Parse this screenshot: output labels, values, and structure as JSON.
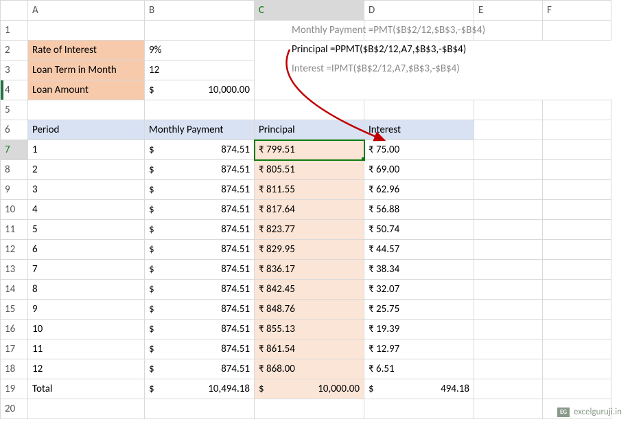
{
  "columns": [
    "A",
    "B",
    "C",
    "D",
    "E",
    "F"
  ],
  "labels": {
    "rate": "Rate of Interest",
    "term": "Loan Term in Month",
    "amount": "Loan Amount"
  },
  "values": {
    "rate": "9%",
    "term": "12",
    "amount_sym": "$",
    "amount_val": "10,000.00"
  },
  "headers": {
    "period": "Period",
    "monthly": "Monthly Payment",
    "principal": "Principal",
    "interest": "Interest"
  },
  "rows": [
    {
      "r": "7",
      "p": "1",
      "m": "874.51",
      "pr": "₹ 799.51",
      "it": "₹ 75.00"
    },
    {
      "r": "8",
      "p": "2",
      "m": "874.51",
      "pr": "₹ 805.51",
      "it": "₹ 69.00"
    },
    {
      "r": "9",
      "p": "3",
      "m": "874.51",
      "pr": "₹ 811.55",
      "it": "₹ 62.96"
    },
    {
      "r": "10",
      "p": "4",
      "m": "874.51",
      "pr": "₹ 817.64",
      "it": "₹ 56.88"
    },
    {
      "r": "11",
      "p": "5",
      "m": "874.51",
      "pr": "₹ 823.77",
      "it": "₹ 50.74"
    },
    {
      "r": "12",
      "p": "6",
      "m": "874.51",
      "pr": "₹ 829.95",
      "it": "₹ 44.57"
    },
    {
      "r": "13",
      "p": "7",
      "m": "874.51",
      "pr": "₹ 836.17",
      "it": "₹ 38.34"
    },
    {
      "r": "14",
      "p": "8",
      "m": "874.51",
      "pr": "₹ 842.45",
      "it": "₹ 32.07"
    },
    {
      "r": "15",
      "p": "9",
      "m": "874.51",
      "pr": "₹ 848.76",
      "it": "₹ 25.75"
    },
    {
      "r": "16",
      "p": "10",
      "m": "874.51",
      "pr": "₹ 855.13",
      "it": "₹ 19.39"
    },
    {
      "r": "17",
      "p": "11",
      "m": "874.51",
      "pr": "₹ 861.54",
      "it": "₹ 12.97"
    },
    {
      "r": "18",
      "p": "12",
      "m": "874.51",
      "pr": "₹ 868.00",
      "it": "₹ 6.51"
    }
  ],
  "total": {
    "r": "19",
    "label": "Total",
    "m_sym": "$",
    "m_val": "10,494.18",
    "pr_sym": "$",
    "pr_val": "10,000.00",
    "it_sym": "$",
    "it_val": "494.18"
  },
  "formulas": {
    "f1": "Monthly Payment =PMT($B$2/12,$B$3,-$B$4)",
    "f2": "Principal =PPMT($B$2/12,A7,$B$3,-$B$4)",
    "f3": "Interest =IPMT($B$2/12,A7,$B$3,-$B$4)"
  },
  "watermark": "excelguruji.in",
  "logo": "EG"
}
